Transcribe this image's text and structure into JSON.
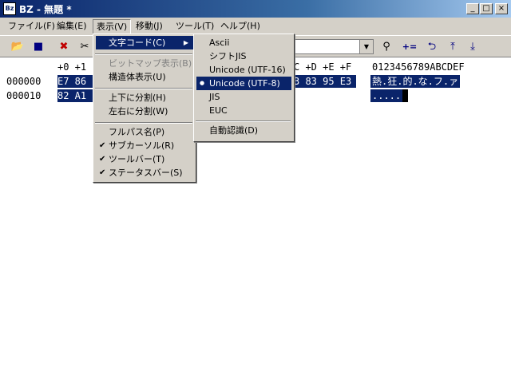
{
  "window": {
    "title": "BZ - 無題 *",
    "minimize": "_",
    "maximize": "□",
    "close": "×",
    "app_icon": "Bz"
  },
  "menubar": [
    {
      "label": "ファイル(F)"
    },
    {
      "label": "編集(E)"
    },
    {
      "label": "表示(V)"
    },
    {
      "label": "移動(J)"
    },
    {
      "label": "ツール(T)"
    },
    {
      "label": "ヘルプ(H)"
    }
  ],
  "toolbar": {
    "open": "📂",
    "save": "■",
    "delete": "✖",
    "cut": "✂",
    "search": "⚲",
    "plus_eq": "+=",
    "undo": "⮌",
    "up": "⤒",
    "down": "⤓",
    "combo_arrow": "▼"
  },
  "hex": {
    "header_left": "+0 +1",
    "header_right": "C +D +E +F",
    "header_ascii": "0123456789ABCDEF",
    "rows": [
      {
        "addr": "000000",
        "bytes_left": "E7 86",
        "bytes_right": "3 83 95 E3",
        "ascii": "熱.狂.的.な.フ.ァ"
      },
      {
        "addr": "000010",
        "bytes_left": "82 A1",
        "ascii_part1": ".....",
        "ascii_part2": " "
      }
    ]
  },
  "view_menu": {
    "items": [
      {
        "label": "文字コード(C)"
      },
      {
        "label": "ビットマップ表示(B)"
      },
      {
        "label": "構造体表示(U)"
      },
      {
        "label": "上下に分割(H)"
      },
      {
        "label": "左右に分割(W)"
      },
      {
        "label": "フルパス名(P)"
      },
      {
        "label": "サブカーソル(R)"
      },
      {
        "label": "ツールバー(T)"
      },
      {
        "label": "ステータスバー(S)"
      }
    ],
    "check": "✔",
    "arrow": "▶"
  },
  "charset_menu": {
    "items": [
      {
        "label": "Ascii"
      },
      {
        "label": "シフトJIS"
      },
      {
        "label": "Unicode (UTF-16)"
      },
      {
        "label": "Unicode (UTF-8)"
      },
      {
        "label": "JIS"
      },
      {
        "label": "EUC"
      },
      {
        "label": "自動認識(D)"
      }
    ],
    "bullet": "●"
  }
}
